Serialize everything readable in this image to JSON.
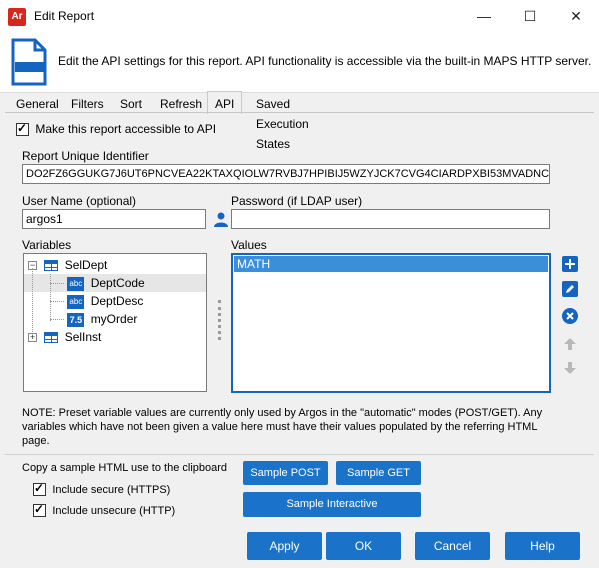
{
  "window": {
    "title": "Edit Report",
    "app_icon_text": "Ar",
    "minimize": "—",
    "maximize": "☐",
    "close": "✕"
  },
  "header": {
    "text": "Edit the API settings for this report.  API functionality is accessible via the built-in MAPS HTTP server."
  },
  "tabs": [
    {
      "label": "General"
    },
    {
      "label": "Filters"
    },
    {
      "label": "Sort"
    },
    {
      "label": "Refresh"
    },
    {
      "label": "API",
      "active": true
    },
    {
      "label": "Saved Execution States"
    }
  ],
  "api": {
    "accessible_label": "Make this report accessible to API",
    "accessible_checked": true,
    "uid_label": "Report Unique Identifier",
    "uid_value": "DO2FZ6GGUKG7J6UT6PNCVEA22KTAXQIOLW7RVBJ7HPIBIJ5WZYJCK7CVG4CIARDPXBI53MVADNCNS",
    "username_label": "User Name (optional)",
    "username_value": "argos1",
    "password_label": "Password (if LDAP user)",
    "password_value": "",
    "variables_label": "Variables",
    "values_label": "Values",
    "variables": [
      {
        "name": "SelDept",
        "icon": "table-icon",
        "expanded": true,
        "children": [
          {
            "name": "DeptCode",
            "type_badge": "abc",
            "selected": true
          },
          {
            "name": "DeptDesc",
            "type_badge": "abc"
          },
          {
            "name": "myOrder",
            "type_badge": "7.5"
          }
        ]
      },
      {
        "name": "SelInst",
        "icon": "table-icon",
        "expanded": false,
        "children": []
      }
    ],
    "values": [
      "MATH"
    ],
    "note": "NOTE: Preset variable values are currently only used by Argos in the \"automatic\" modes (POST/GET).  Any variables which have not been given a value here must have their values populated by the referring HTML page.",
    "copy_label": "Copy a sample HTML use to the clipboard",
    "include_secure_label": "Include secure (HTTPS)",
    "include_secure_checked": true,
    "include_unsecure_label": "Include unsecure (HTTP)",
    "include_unsecure_checked": true,
    "sample_post": "Sample POST",
    "sample_get": "Sample GET",
    "sample_interactive": "Sample Interactive"
  },
  "buttons": {
    "apply": "Apply",
    "ok": "OK",
    "cancel": "Cancel",
    "help": "Help"
  },
  "colors": {
    "accent": "#1a73c8",
    "selection": "#3b8fd8",
    "brand_red": "#d9261c"
  }
}
